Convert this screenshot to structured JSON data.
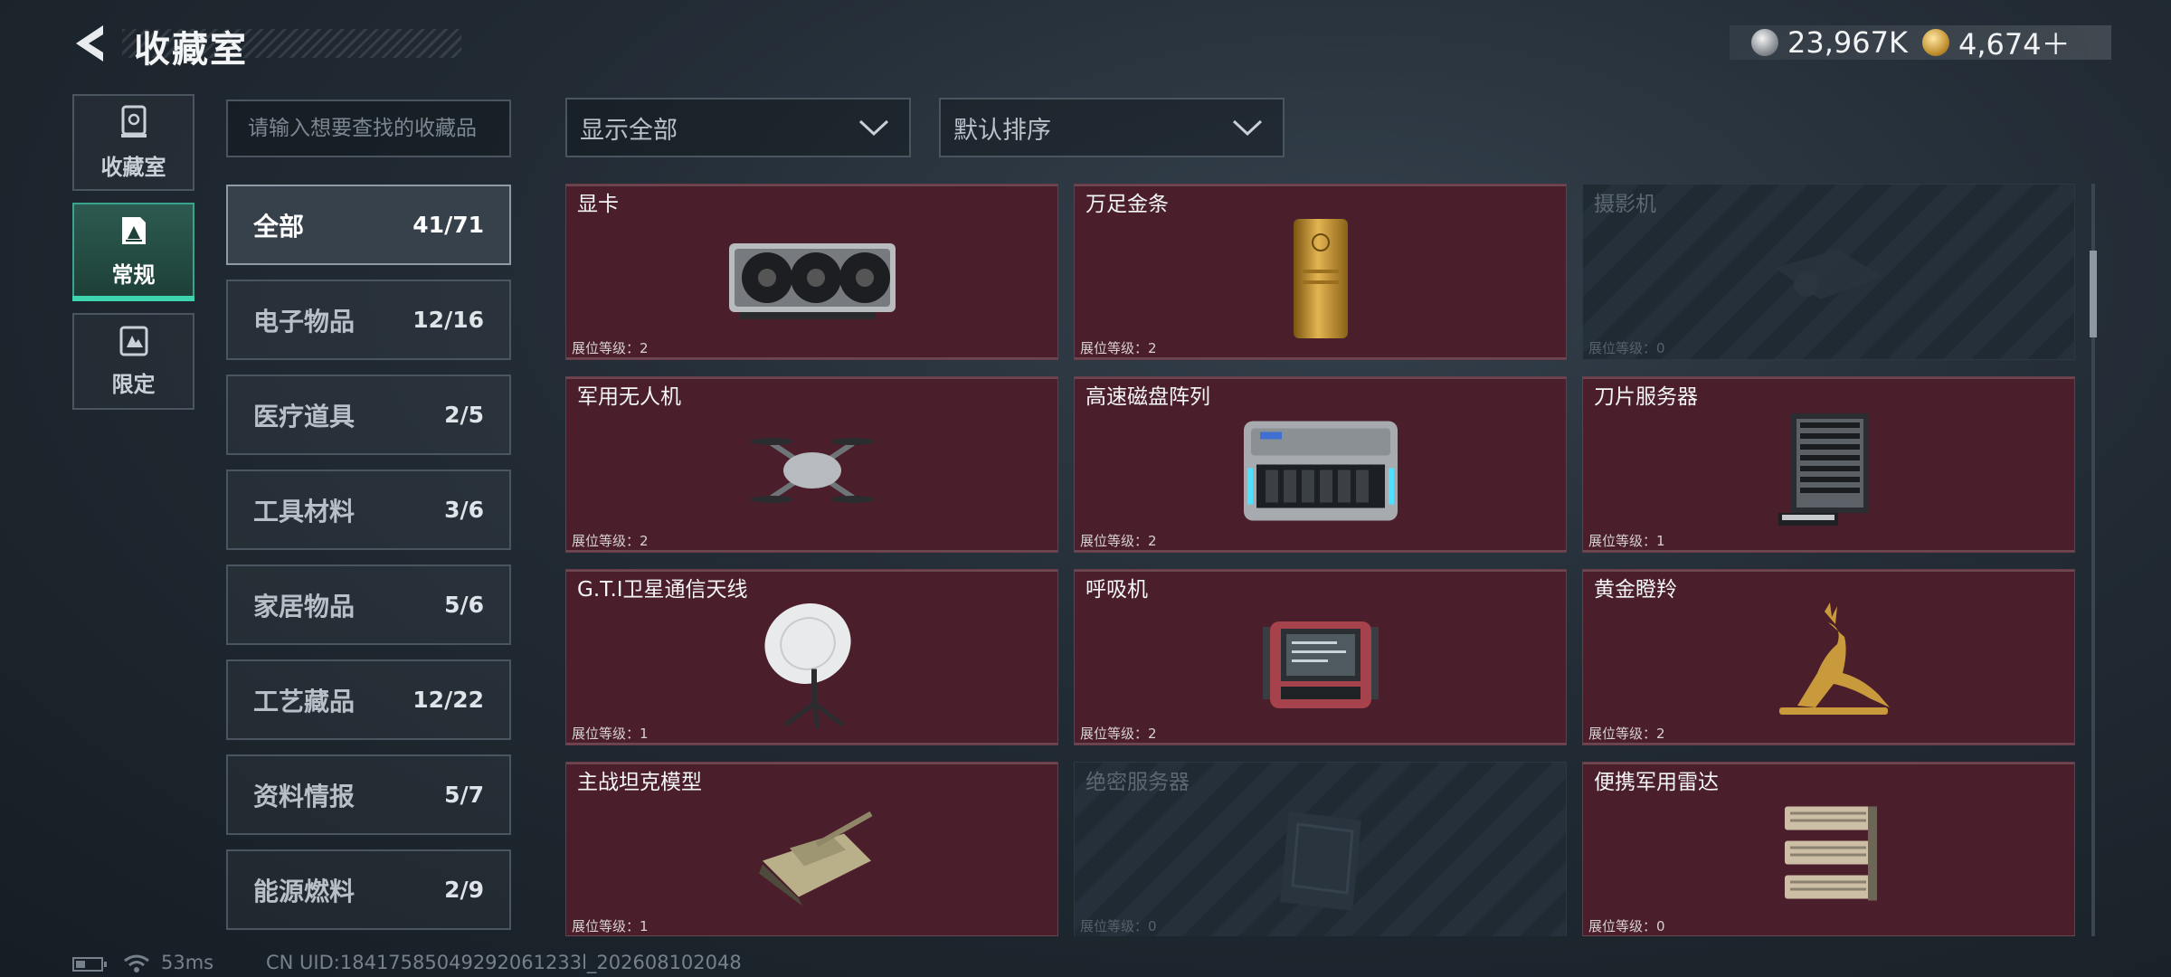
{
  "header": {
    "title": "收藏室",
    "currency": [
      {
        "icon": "silver-coin-icon",
        "value": "23,967K"
      },
      {
        "icon": "gold-coin-icon",
        "value": "4,674＋"
      }
    ]
  },
  "nav": [
    {
      "label": "收藏室",
      "icon": "vault-icon",
      "active": false
    },
    {
      "label": "常规",
      "icon": "regular-collection-icon",
      "active": true
    },
    {
      "label": "限定",
      "icon": "limited-collection-icon",
      "active": false
    }
  ],
  "search": {
    "placeholder": "请输入想要查找的收藏品"
  },
  "filters": {
    "display": "显示全部",
    "sort": "默认排序"
  },
  "categories": [
    {
      "name": "全部",
      "count": "41/71",
      "active": true
    },
    {
      "name": "电子物品",
      "count": "12/16"
    },
    {
      "name": "医疗道具",
      "count": "2/5"
    },
    {
      "name": "工具材料",
      "count": "3/6"
    },
    {
      "name": "家居物品",
      "count": "5/6"
    },
    {
      "name": "工艺藏品",
      "count": "12/22"
    },
    {
      "name": "资料情报",
      "count": "5/7"
    },
    {
      "name": "能源燃料",
      "count": "2/9"
    }
  ],
  "items": [
    {
      "name": "显卡",
      "level": "展位等级：2",
      "locked": false,
      "icon": "graphics-card-icon"
    },
    {
      "name": "万足金条",
      "level": "展位等级：2",
      "locked": false,
      "icon": "gold-bar-icon"
    },
    {
      "name": "摄影机",
      "level": "展位等级：0",
      "locked": true,
      "icon": "camera-icon"
    },
    {
      "name": "军用无人机",
      "level": "展位等级：2",
      "locked": false,
      "icon": "drone-icon"
    },
    {
      "name": "高速磁盘阵列",
      "level": "展位等级：2",
      "locked": false,
      "icon": "disk-array-icon"
    },
    {
      "name": "刀片服务器",
      "level": "展位等级：1",
      "locked": false,
      "icon": "blade-server-icon"
    },
    {
      "name": "G.T.I卫星通信天线",
      "level": "展位等级：1",
      "locked": false,
      "icon": "satellite-antenna-icon"
    },
    {
      "name": "呼吸机",
      "level": "展位等级：2",
      "locked": false,
      "icon": "ventilator-icon"
    },
    {
      "name": "黄金瞪羚",
      "level": "展位等级：2",
      "locked": false,
      "icon": "golden-gazelle-icon"
    },
    {
      "name": "主战坦克模型",
      "level": "展位等级：1",
      "locked": false,
      "icon": "tank-model-icon"
    },
    {
      "name": "绝密服务器",
      "level": "展位等级：0",
      "locked": true,
      "icon": "secret-server-icon"
    },
    {
      "name": "便携军用雷达",
      "level": "展位等级：0",
      "locked": false,
      "icon": "portable-radar-icon"
    }
  ],
  "status": {
    "ping": "53ms",
    "uid": "CN UID:18417585049292061233l_202608102048"
  }
}
